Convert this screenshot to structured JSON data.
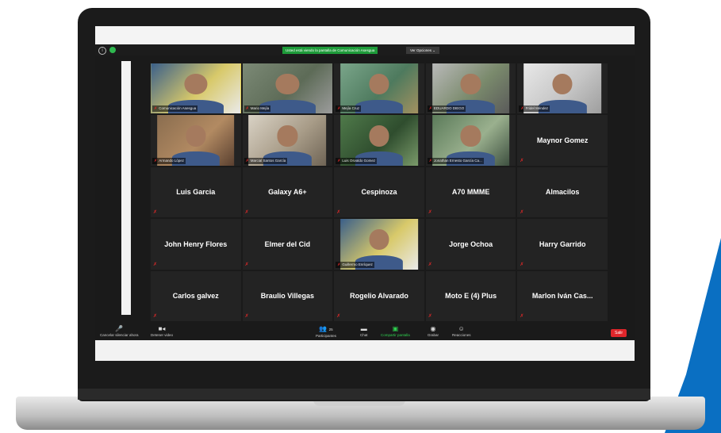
{
  "meeting": {
    "share_banner": "Usted está viendo la pantalla de Comunicación Asesgua",
    "view_options": "Ver Opciones ⌄"
  },
  "participants": [
    {
      "name": "Comunicación Asesgua",
      "video": true,
      "active": true
    },
    {
      "name": "Mario Mejía",
      "video": true
    },
    {
      "name": "Mejía Cruz",
      "video": true
    },
    {
      "name": "EDUARDO DIEGO",
      "video": true
    },
    {
      "name": "Fridel Méndez",
      "video": true
    },
    {
      "name": "Armando López",
      "video": true
    },
    {
      "name": "Marcial Santos García",
      "video": true
    },
    {
      "name": "Luis Osvaldo Gomez",
      "video": true
    },
    {
      "name": "Jonathan Ernesto García Ca...",
      "video": true
    },
    {
      "name": "Maynor Gomez",
      "video": false
    },
    {
      "name": "Luis Garcia",
      "video": false
    },
    {
      "name": "Galaxy A6+",
      "video": false
    },
    {
      "name": "Cespinoza",
      "video": false
    },
    {
      "name": "A70 MMME",
      "video": false
    },
    {
      "name": "Almacilos",
      "video": false
    },
    {
      "name": "John Henry Flores",
      "video": false
    },
    {
      "name": "Elmer del Cid",
      "video": false
    },
    {
      "name": "Guillermo Enríquez",
      "video": true
    },
    {
      "name": "Jorge Ochoa",
      "video": false
    },
    {
      "name": "Harry Garrido",
      "video": false
    },
    {
      "name": "Carlos galvez",
      "video": false
    },
    {
      "name": "Braulio Villegas",
      "video": false
    },
    {
      "name": "Rogelio Alvarado",
      "video": false
    },
    {
      "name": "Moto E (4) Plus",
      "video": false
    },
    {
      "name": "Marlon Iván Cas...",
      "video": false
    }
  ],
  "toolbar": {
    "unmute": "Cancelar silenciar ahora",
    "stop_video": "Detener video",
    "participants": "Participantes",
    "participants_count": "25",
    "chat": "Chat",
    "share": "Compartir pantalla",
    "record": "Grabar",
    "reactions": "Reacciones",
    "leave": "Salir"
  },
  "colors": {
    "accent_green": "#1e9b3a",
    "leave_red": "#e0262b",
    "active_speaker": "#e7d23b",
    "deco_blue": "#0a6fc2"
  }
}
